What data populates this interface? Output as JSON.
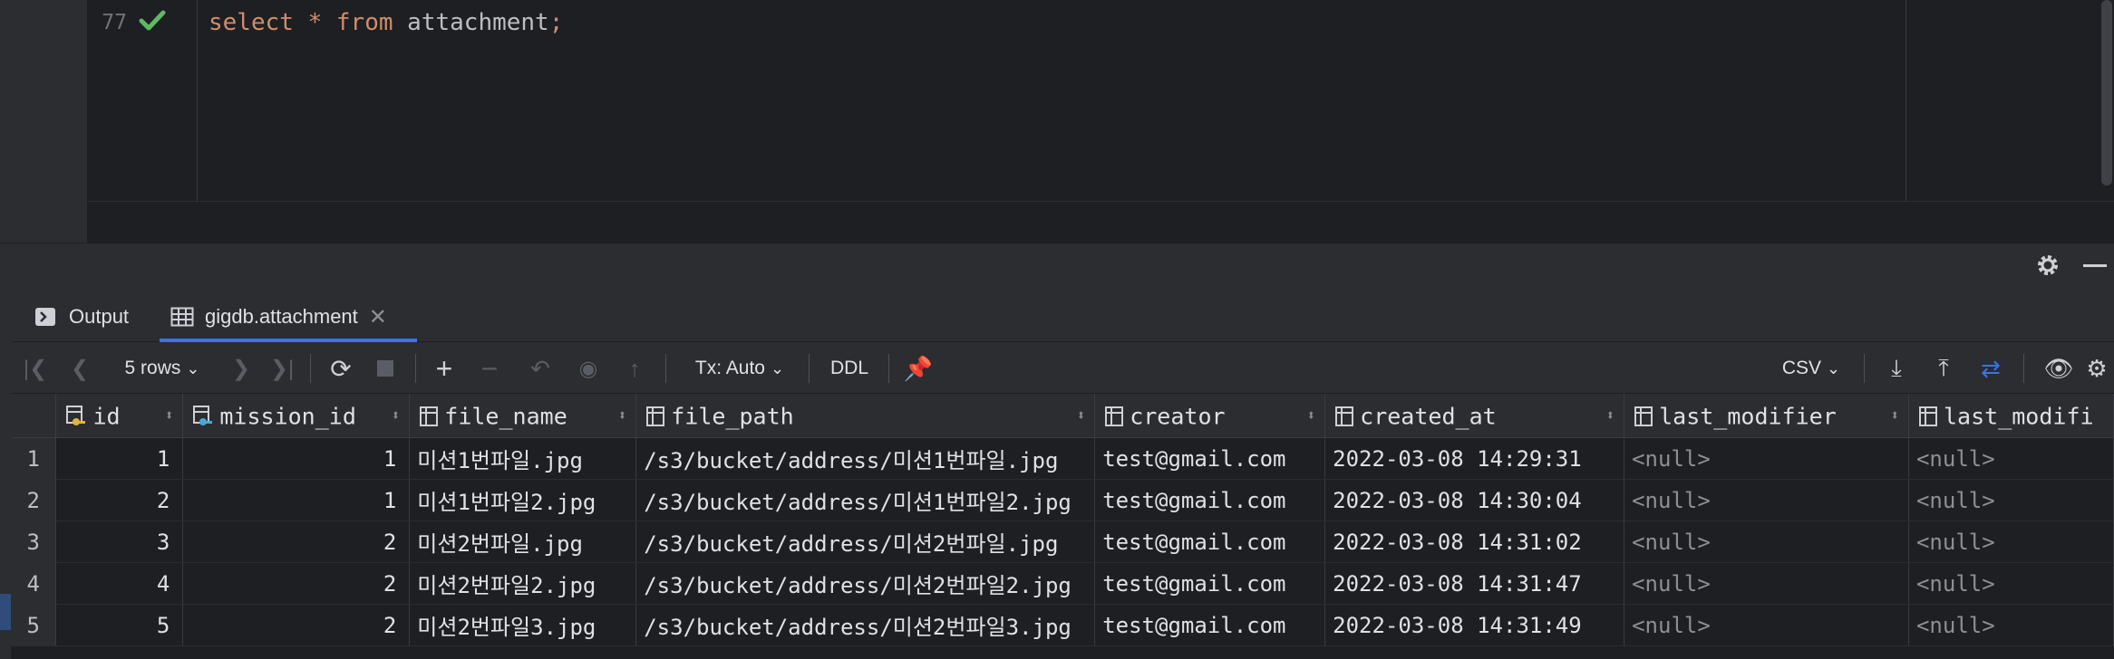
{
  "editor": {
    "line_number": "77",
    "code": {
      "kw_select": "select",
      "star": "*",
      "kw_from": "from",
      "table": "attachment",
      "semicolon": ";"
    }
  },
  "tabs": [
    {
      "label": "Output",
      "icon": "console-icon"
    },
    {
      "label": "gigdb.attachment",
      "icon": "table-icon"
    }
  ],
  "toolbar": {
    "rows_label": "5 rows",
    "tx_label": "Tx: Auto",
    "ddl_label": "DDL",
    "csv_label": "CSV"
  },
  "grid": {
    "columns": [
      "id",
      "mission_id",
      "file_name",
      "file_path",
      "creator",
      "created_at",
      "last_modifier",
      "last_modifi"
    ],
    "rows": [
      {
        "n": "1",
        "id": "1",
        "mission_id": "1",
        "file_name": "미션1번파일.jpg",
        "file_path": "/s3/bucket/address/미션1번파일.jpg",
        "creator": "test@gmail.com",
        "created_at": "2022-03-08 14:29:31",
        "last_modifier": "<null>",
        "last_modified": "<null>"
      },
      {
        "n": "2",
        "id": "2",
        "mission_id": "1",
        "file_name": "미션1번파일2.jpg",
        "file_path": "/s3/bucket/address/미션1번파일2.jpg",
        "creator": "test@gmail.com",
        "created_at": "2022-03-08 14:30:04",
        "last_modifier": "<null>",
        "last_modified": "<null>"
      },
      {
        "n": "3",
        "id": "3",
        "mission_id": "2",
        "file_name": "미션2번파일.jpg",
        "file_path": "/s3/bucket/address/미션2번파일.jpg",
        "creator": "test@gmail.com",
        "created_at": "2022-03-08 14:31:02",
        "last_modifier": "<null>",
        "last_modified": "<null>"
      },
      {
        "n": "4",
        "id": "4",
        "mission_id": "2",
        "file_name": "미션2번파일2.jpg",
        "file_path": "/s3/bucket/address/미션2번파일2.jpg",
        "creator": "test@gmail.com",
        "created_at": "2022-03-08 14:31:47",
        "last_modifier": "<null>",
        "last_modified": "<null>"
      },
      {
        "n": "5",
        "id": "5",
        "mission_id": "2",
        "file_name": "미션2번파일3.jpg",
        "file_path": "/s3/bucket/address/미션2번파일3.jpg",
        "creator": "test@gmail.com",
        "created_at": "2022-03-08 14:31:49",
        "last_modifier": "<null>",
        "last_modified": "<null>"
      }
    ]
  },
  "colors": {
    "accent": "#3574f0",
    "check": "#5fb865",
    "keyword": "#cf8e6d"
  }
}
